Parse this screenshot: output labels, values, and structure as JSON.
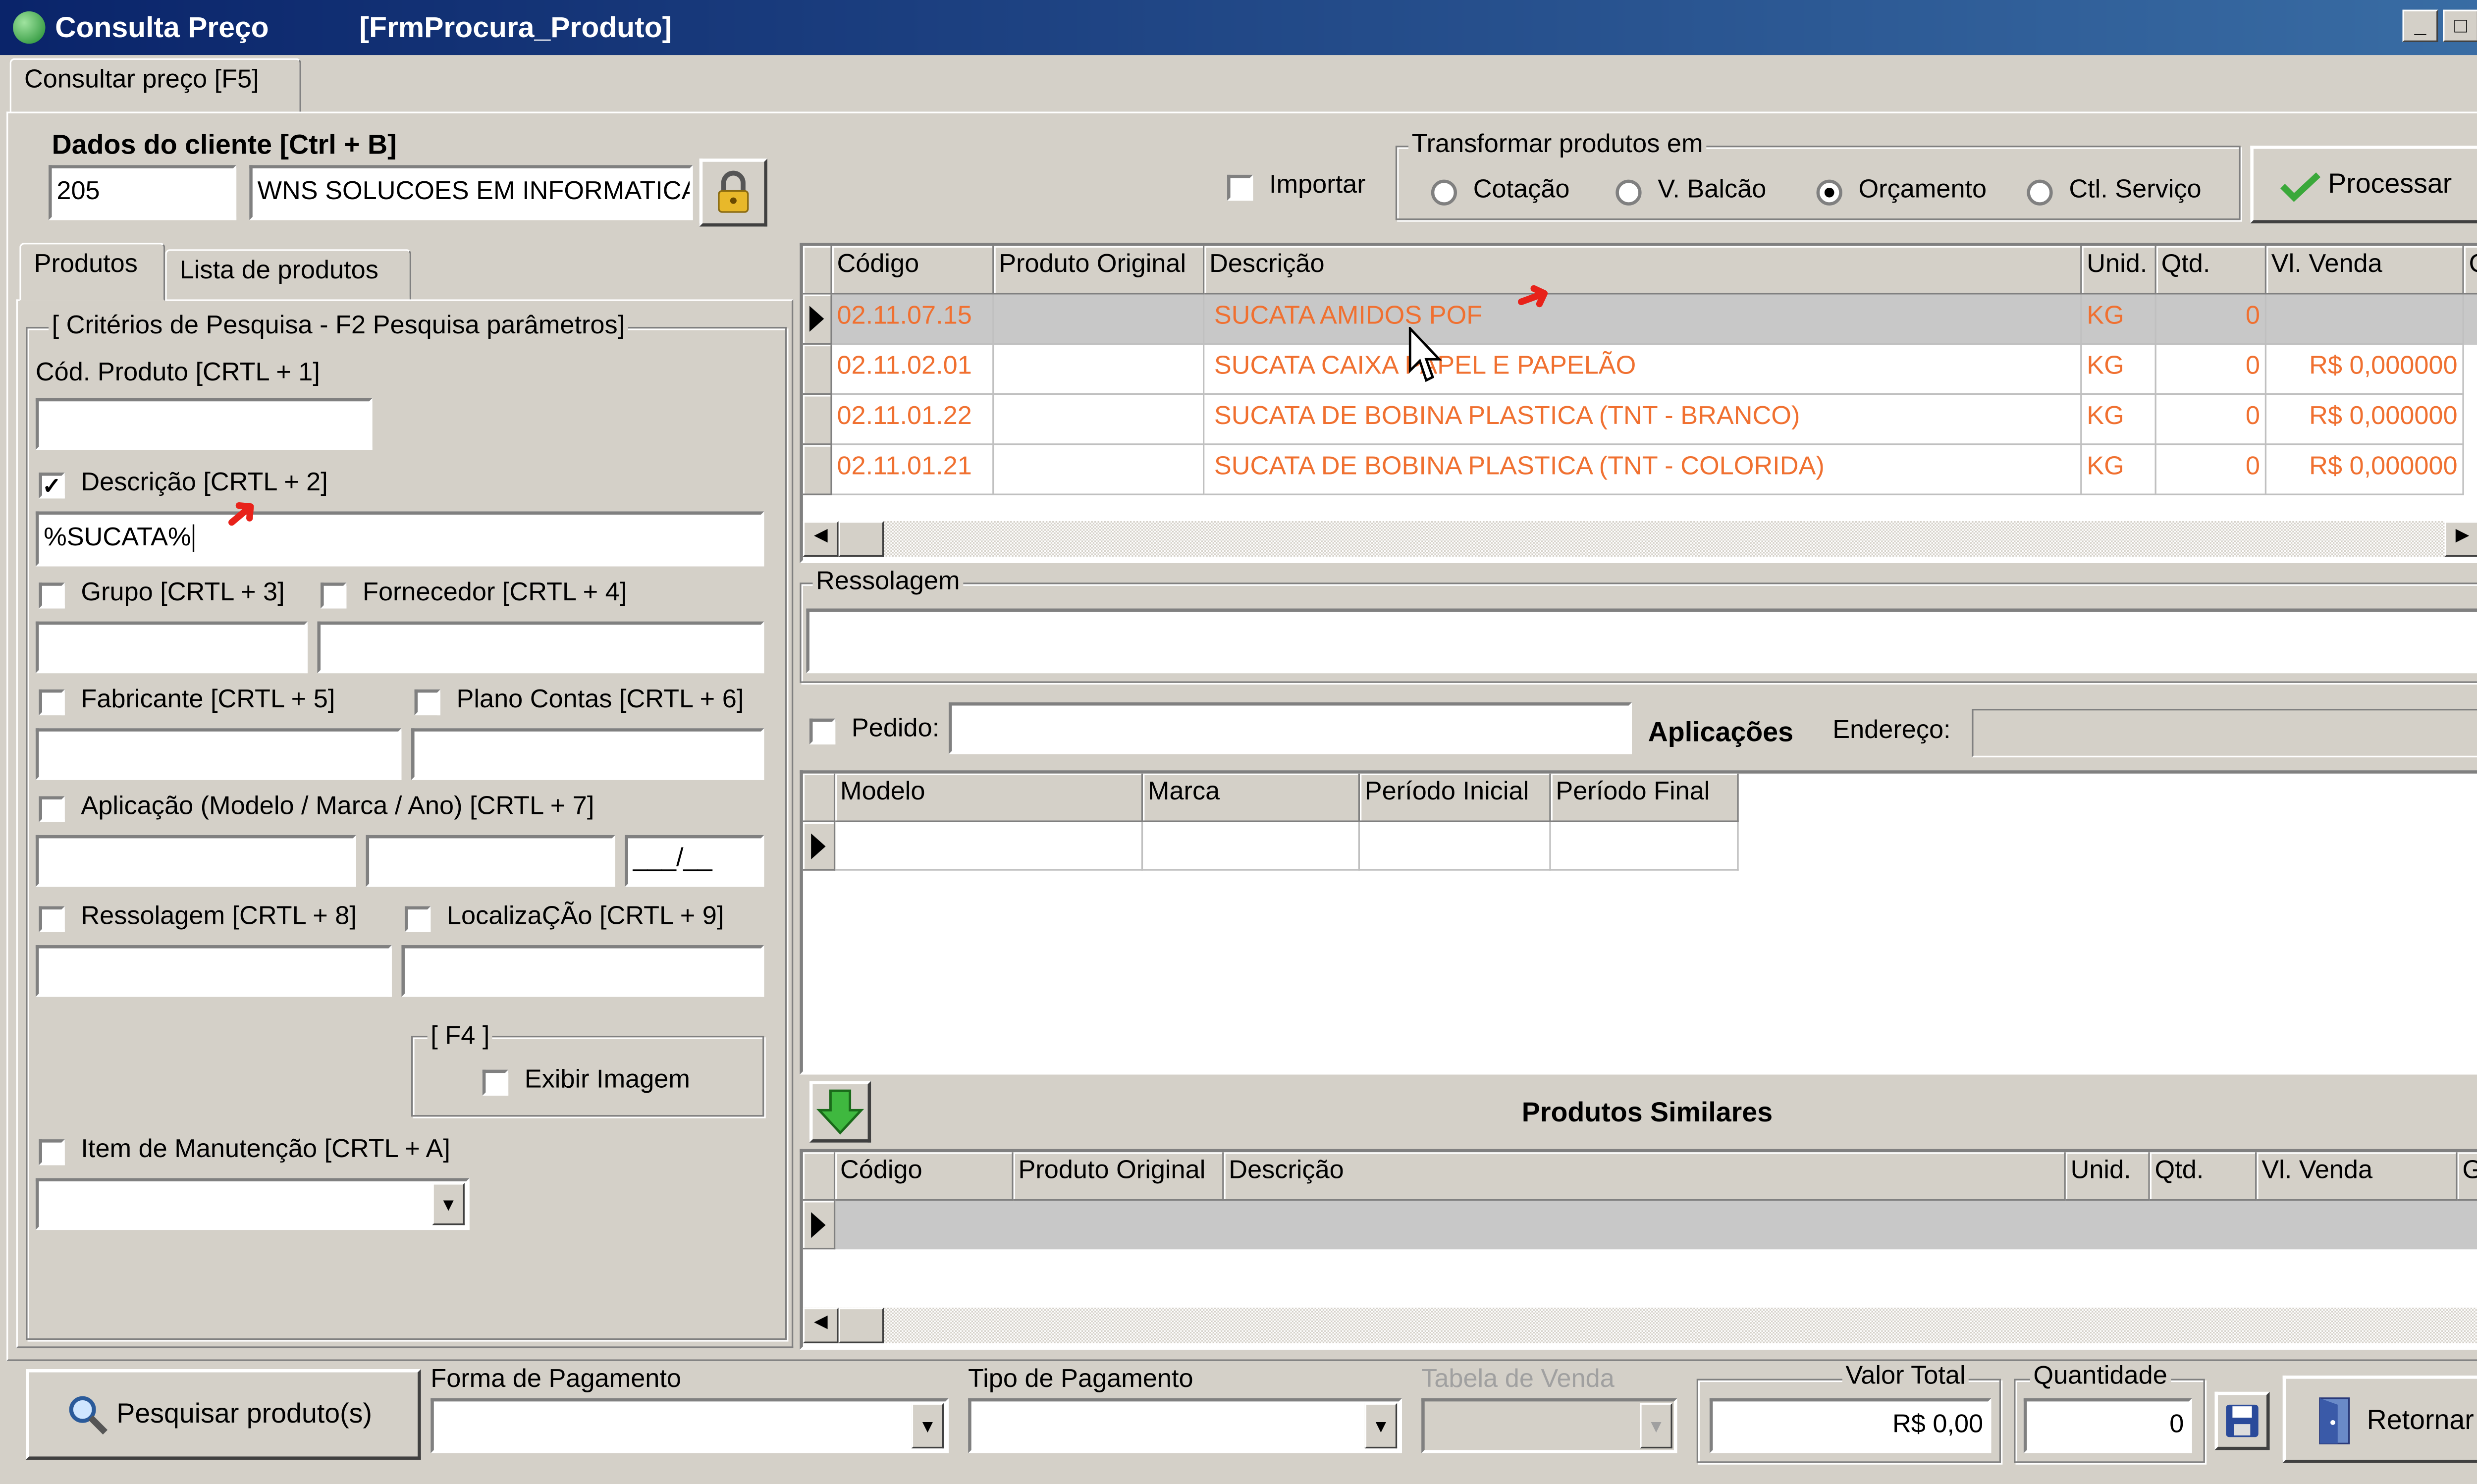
{
  "window": {
    "title": "Consulta Preço",
    "form": "[FrmProcura_Produto]"
  },
  "main_tab": "Consultar preço [F5]",
  "client": {
    "label": "Dados do cliente [Ctrl + B]",
    "code": "205",
    "name": "WNS SOLUCOES EM INFORMATICA"
  },
  "importar": "Importar",
  "transform": {
    "title": "Transformar produtos em",
    "options": [
      "Cotação",
      "V. Balcão",
      "Orçamento",
      "Ctl. Serviço"
    ],
    "selected": "Orçamento"
  },
  "processar": "Processar",
  "left_tabs": [
    "Produtos",
    "Lista de produtos"
  ],
  "criteria": {
    "title": "[ Critérios de Pesquisa - F2 Pesquisa parâmetros]",
    "cod_produto": "Cód. Produto  [CRTL + 1]",
    "descricao": "Descrição [CRTL + 2]",
    "descricao_value": "%SUCATA%",
    "grupo": "Grupo [CRTL + 3]",
    "fornecedor": "Fornecedor [CRTL + 4]",
    "fabricante": "Fabricante [CRTL + 5]",
    "plano_contas": "Plano Contas [CRTL + 6]",
    "aplicacao": "Aplicação (Modelo / Marca / Ano) [CRTL + 7]",
    "ano_mask": "___/__",
    "ressolagem": "Ressolagem [CRTL + 8]",
    "localizacao": "LocalizaÇÃo [CRTL + 9]",
    "f4": "[ F4 ]",
    "exibir_imagem": "Exibir Imagem",
    "item_manutencao": "Item de Manutenção [CRTL + A]"
  },
  "products_grid": {
    "headers": [
      "Código",
      "Produto Original",
      "Descrição",
      "Unid.",
      "Qtd.",
      "Vl. Venda",
      "C"
    ],
    "rows": [
      {
        "codigo": "02.11.07.15",
        "original": "",
        "descricao": "SUCATA AMIDOS POF",
        "unid": "KG",
        "qtd": "0",
        "venda": ""
      },
      {
        "codigo": "02.11.02.01",
        "original": "",
        "descricao": "SUCATA CAIXA PAPEL E PAPELÃO",
        "unid": "KG",
        "qtd": "0",
        "venda": "R$ 0,000000"
      },
      {
        "codigo": "02.11.01.22",
        "original": "",
        "descricao": "SUCATA DE  BOBINA PLASTICA (TNT -  BRANCO)",
        "unid": "KG",
        "qtd": "0",
        "venda": "R$ 0,000000"
      },
      {
        "codigo": "02.11.01.21",
        "original": "",
        "descricao": "SUCATA DE  BOBINA PLASTICA (TNT -  COLORIDA)",
        "unid": "KG",
        "qtd": "0",
        "venda": "R$ 0,000000"
      }
    ]
  },
  "ressolagem_title": "Ressolagem",
  "pedido": "Pedido:",
  "aplicacoes": "Aplicações",
  "endereco": "Endereço:",
  "apps_grid": {
    "headers": [
      "Modelo",
      "Marca",
      "Período Inicial",
      "Período Final"
    ]
  },
  "similares": {
    "title": "Produtos Similares",
    "headers": [
      "Código",
      "Produto Original",
      "Descrição",
      "Unid.",
      "Qtd.",
      "Vl. Venda",
      "Gara"
    ]
  },
  "footer": {
    "pesquisar": "Pesquisar produto(s)",
    "forma_pagamento": "Forma de Pagamento",
    "tipo_pagamento": "Tipo de Pagamento",
    "tabela_venda": "Tabela de Venda",
    "valor_total_label": "Valor Total",
    "valor_total": "R$ 0,00",
    "quantidade_label": "Quantidade",
    "quantidade": "0",
    "retornar": "Retornar"
  },
  "colors": {
    "row_text": "#f07030",
    "title_from": "#0a246a",
    "title_to": "#3a6ea5",
    "arrow": "#e8221a"
  }
}
